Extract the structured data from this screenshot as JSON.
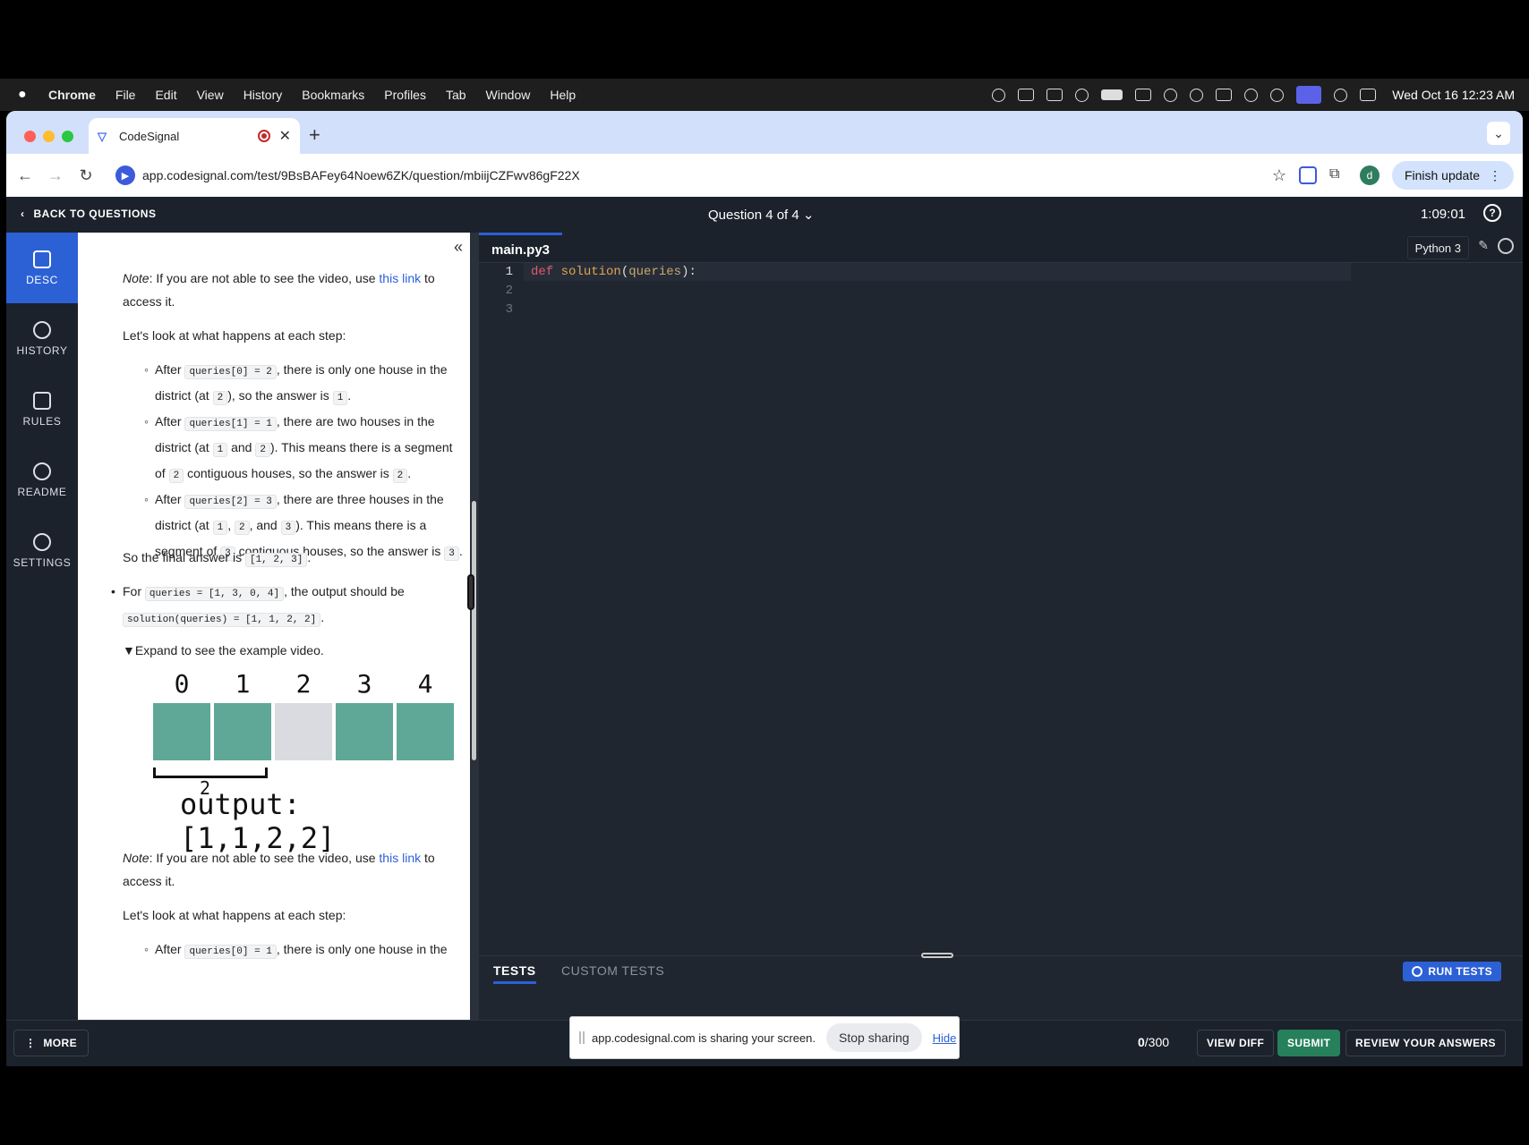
{
  "menubar": {
    "app": "Chrome",
    "items": [
      "File",
      "Edit",
      "View",
      "History",
      "Bookmarks",
      "Profiles",
      "Tab",
      "Window",
      "Help"
    ],
    "clock": "Wed Oct 16  12:23 AM"
  },
  "browser": {
    "tab_title": "CodeSignal",
    "url": "app.codesignal.com/test/9BsBAFey64Noew6ZK/question/mbiijCZFwv86gF22X",
    "finish_update": "Finish update",
    "avatar_letter": "d"
  },
  "app": {
    "back_label": "BACK TO QUESTIONS",
    "question_selector": "Question 4 of 4",
    "timer": "1:09:01",
    "sidenav": [
      "DESC",
      "HISTORY",
      "RULES",
      "README",
      "SETTINGS"
    ]
  },
  "desc": {
    "note1_prefix": "Note",
    "note1_a": ": If you are not able to see the video, use ",
    "note1_link": "this link",
    "note1_b": " to access it.",
    "steps_intro1": "Let's look at what happens at each step:",
    "s1_a": "After ",
    "s1_code": "queries[0] = 2",
    "s1_b": ", there is only one house in the district (at ",
    "s1_c1": "2",
    "s1_d": "), so the answer is ",
    "s1_c2": "1",
    "s1_e": ".",
    "s2_a": "After ",
    "s2_code": "queries[1] = 1",
    "s2_b": ", there are two houses in the district (at ",
    "s2_c1": "1",
    "s2_d": " and ",
    "s2_c2": "2",
    "s2_e": "). This means there is a segment of ",
    "s2_c3": "2",
    "s2_f": " contiguous houses, so the answer is ",
    "s2_c4": "2",
    "s2_g": ".",
    "s3_a": "After ",
    "s3_code": "queries[2] = 3",
    "s3_b": ", there are three houses in the district (at ",
    "s3_c1": "1",
    "s3_sep1": ", ",
    "s3_c2": "2",
    "s3_sep2": ", and ",
    "s3_c3": "3",
    "s3_d": "). This means there is a segment of ",
    "s3_c4": "3",
    "s3_e": " contiguous houses, so the answer is ",
    "s3_c5": "3",
    "s3_f": ".",
    "final_a": "So the final answer is ",
    "final_code": "[1, 2, 3]",
    "final_b": ".",
    "ex_a": "For ",
    "ex_code1": "queries = [1, 3, 0, 4]",
    "ex_b": ", the output should be ",
    "ex_code2": "solution(queries) = [1, 1, 2, 2]",
    "ex_c": ".",
    "expand": "▼Expand to see the example video.",
    "diagram": {
      "labels": [
        "0",
        "1",
        "2",
        "3",
        "4"
      ],
      "filled": [
        true,
        true,
        false,
        true,
        true
      ],
      "bracket_label": "2",
      "output": "output: [1,1,2,2]",
      "fill_color": "#5fa898",
      "empty_color": "#d9dbe0"
    },
    "note2_prefix": "Note",
    "note2_a": ": If you are not able to see the video, use ",
    "note2_link": "this link",
    "note2_b": " to access it.",
    "steps_intro2": "Let's look at what happens at each step:",
    "s4_a": "After ",
    "s4_code": "queries[0] = 1",
    "s4_b": ", there is only one house in the"
  },
  "editor": {
    "file_tab": "main.py3",
    "language": "Python 3",
    "line_numbers": [
      "1",
      "2",
      "3"
    ],
    "code_kw": "def",
    "code_fn": "solution",
    "code_open": "(",
    "code_param": "queries",
    "code_close": "):"
  },
  "tests": {
    "tab_tests": "TESTS",
    "tab_custom": "CUSTOM TESTS",
    "run": "RUN TESTS"
  },
  "footer": {
    "more": "MORE",
    "score_num": "0",
    "score_den": "/300",
    "view_diff": "VIEW DIFF",
    "submit": "SUBMIT",
    "review": "REVIEW YOUR ANSWERS"
  },
  "share_bar": {
    "text": "app.codesignal.com is sharing your screen.",
    "stop": "Stop sharing",
    "hide": "Hide"
  }
}
